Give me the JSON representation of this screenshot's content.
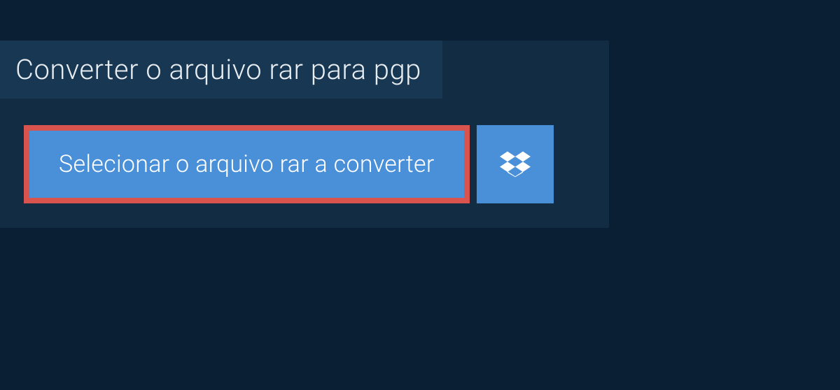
{
  "panel": {
    "title": "Converter o arquivo rar para pgp",
    "select_button_label": "Selecionar o arquivo rar a converter"
  }
}
